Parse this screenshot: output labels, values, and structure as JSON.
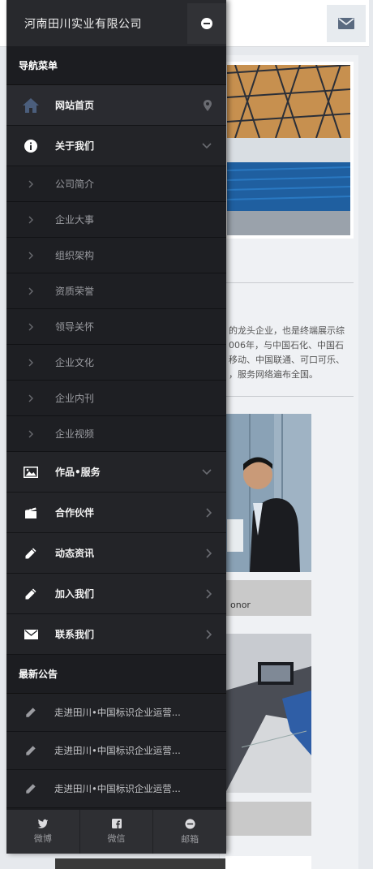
{
  "drawer": {
    "title": "河南田川实业有限公司",
    "nav_header": "导航菜单",
    "items": [
      {
        "label": "网站首页",
        "icon": "home-icon"
      },
      {
        "label": "关于我们",
        "icon": "info-icon"
      },
      {
        "label": "作品•服务",
        "icon": "image-icon"
      },
      {
        "label": "合作伙伴",
        "icon": "clapper-icon"
      },
      {
        "label": "动态资讯",
        "icon": "pencil-icon"
      },
      {
        "label": "加入我们",
        "icon": "pencil-icon"
      },
      {
        "label": "联系我们",
        "icon": "envelope-icon"
      }
    ],
    "subitems": [
      "公司简介",
      "企业大事",
      "组织架构",
      "资质荣誉",
      "领导关怀",
      "企业文化",
      "企业内刊",
      "企业视频"
    ],
    "news_header": "最新公告",
    "news": [
      "走进田川•中国标识企业运营...",
      "走进田川•中国标识企业运营...",
      "走进田川•中国标识企业运营..."
    ],
    "footer": [
      {
        "label": "微博",
        "icon": "bird-icon"
      },
      {
        "label": "微信",
        "icon": "facebook-icon"
      },
      {
        "label": "邮箱",
        "icon": "minus-circle-icon"
      }
    ]
  },
  "background": {
    "about_lines": [
      "的龙头企业，也是终端展示综",
      "006年，与中国石化、中国石",
      "移动、中国联通、可口可乐、",
      "，服务网络遍布全国。"
    ],
    "caption1": "onor"
  },
  "colors": {
    "drawer_bg": "#1a1b1f",
    "row_bg": "#232428",
    "accent": "#4b5e7c"
  }
}
